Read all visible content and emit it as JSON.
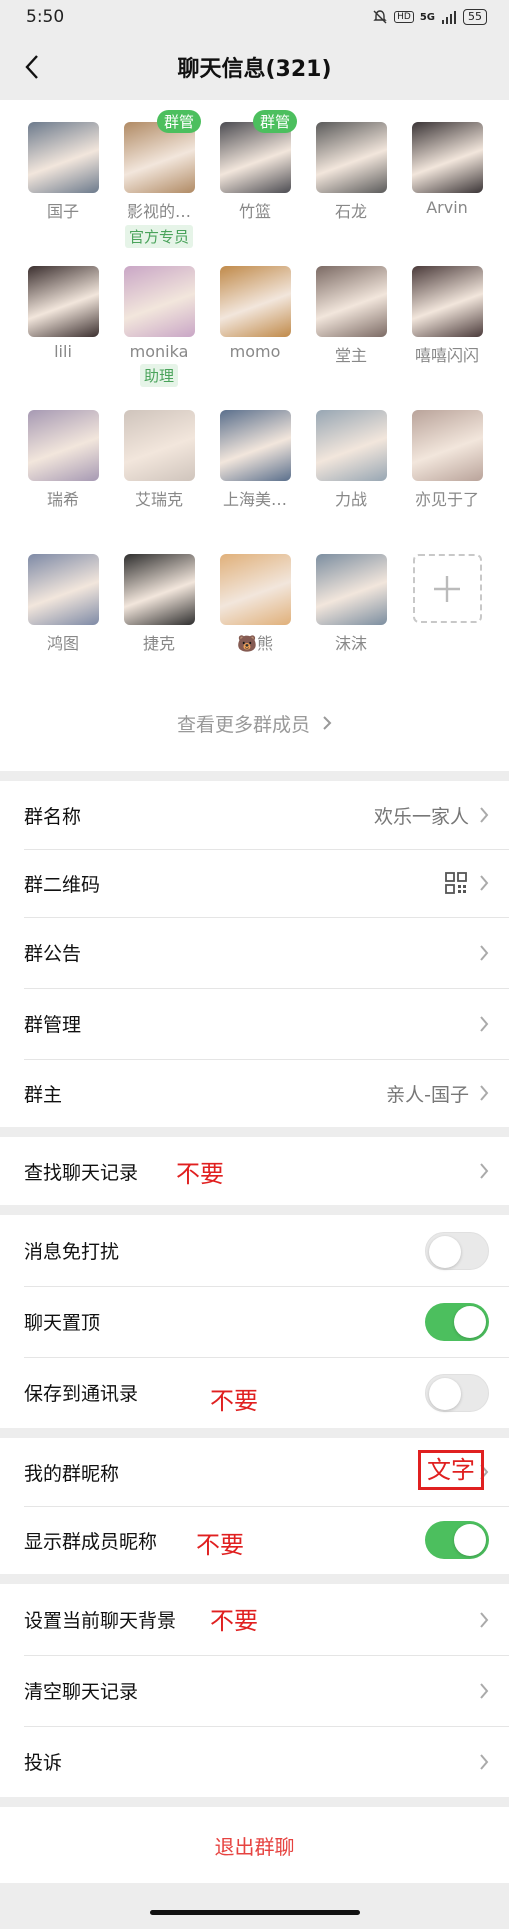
{
  "status_bar": {
    "time": "5:50",
    "network": "5G",
    "hd": "HD",
    "battery": "55"
  },
  "nav": {
    "title": "聊天信息(321)"
  },
  "members": [
    {
      "name": "国子",
      "color": "#6c7a8c",
      "badge": "",
      "tag": ""
    },
    {
      "name": "影视的…",
      "color": "#b08a64",
      "badge": "群管",
      "tag": "官方专员"
    },
    {
      "name": "竹篮",
      "color": "#4c4c52",
      "badge": "群管",
      "tag": ""
    },
    {
      "name": "石龙",
      "color": "#5a5a5a",
      "badge": "",
      "tag": ""
    },
    {
      "name": "Arvin",
      "color": "#3a3436",
      "badge": "",
      "tag": ""
    },
    {
      "name": "lili",
      "color": "#3b2f2f",
      "badge": "",
      "tag": ""
    },
    {
      "name": "monika",
      "color": "#c9a6c6",
      "badge": "",
      "tag": "助理"
    },
    {
      "name": "momo",
      "color": "#c08a4a",
      "badge": "",
      "tag": ""
    },
    {
      "name": "堂主",
      "color": "#7b6a64",
      "badge": "",
      "tag": ""
    },
    {
      "name": "嘻嘻闪闪",
      "color": "#4a3a3a",
      "badge": "",
      "tag": ""
    },
    {
      "name": "瑞希",
      "color": "#a699b3",
      "badge": "",
      "tag": ""
    },
    {
      "name": "艾瑞克",
      "color": "#cfc4bc",
      "badge": "",
      "tag": ""
    },
    {
      "name": "上海美…",
      "color": "#5a6f8c",
      "badge": "",
      "tag": ""
    },
    {
      "name": "力战",
      "color": "#97a6b3",
      "badge": "",
      "tag": ""
    },
    {
      "name": "亦见于了",
      "color": "#b9a39a",
      "badge": "",
      "tag": ""
    },
    {
      "name": "鸿图",
      "color": "#7e8aa6",
      "badge": "",
      "tag": ""
    },
    {
      "name": "捷克",
      "color": "#2e2e2e",
      "badge": "",
      "tag": ""
    },
    {
      "name": "🐻熊",
      "color": "#e0b07a",
      "badge": "",
      "tag": ""
    },
    {
      "name": "沫沫",
      "color": "#7c8ea0",
      "badge": "",
      "tag": ""
    }
  ],
  "add_member_icon": "plus-icon",
  "more_members": "查看更多群成员",
  "group_settings": [
    {
      "label": "群名称",
      "value": "欢乐一家人"
    },
    {
      "label": "群二维码",
      "value": ""
    },
    {
      "label": "群公告",
      "value": ""
    },
    {
      "label": "群管理",
      "value": ""
    },
    {
      "label": "群主",
      "value": "亲人-国子"
    }
  ],
  "search_history": {
    "label": "查找聊天记录",
    "annotation": "不要"
  },
  "toggles": [
    {
      "label": "消息免打扰",
      "state": "off",
      "annotation": ""
    },
    {
      "label": "聊天置顶",
      "state": "on",
      "annotation": ""
    },
    {
      "label": "保存到通讯录",
      "state": "off",
      "annotation": "不要"
    }
  ],
  "nickname": {
    "label": "我的群昵称",
    "annotation": "文字"
  },
  "show_nickname": {
    "label": "显示群成员昵称",
    "state": "on",
    "annotation": "不要"
  },
  "misc": [
    {
      "label": "设置当前聊天背景",
      "annotation": "不要"
    },
    {
      "label": "清空聊天记录",
      "annotation": ""
    },
    {
      "label": "投诉",
      "annotation": ""
    }
  ],
  "exit": "退出群聊",
  "colors": {
    "accent": "#4cbf5e",
    "danger": "#e64340",
    "annotation": "#e02020"
  }
}
